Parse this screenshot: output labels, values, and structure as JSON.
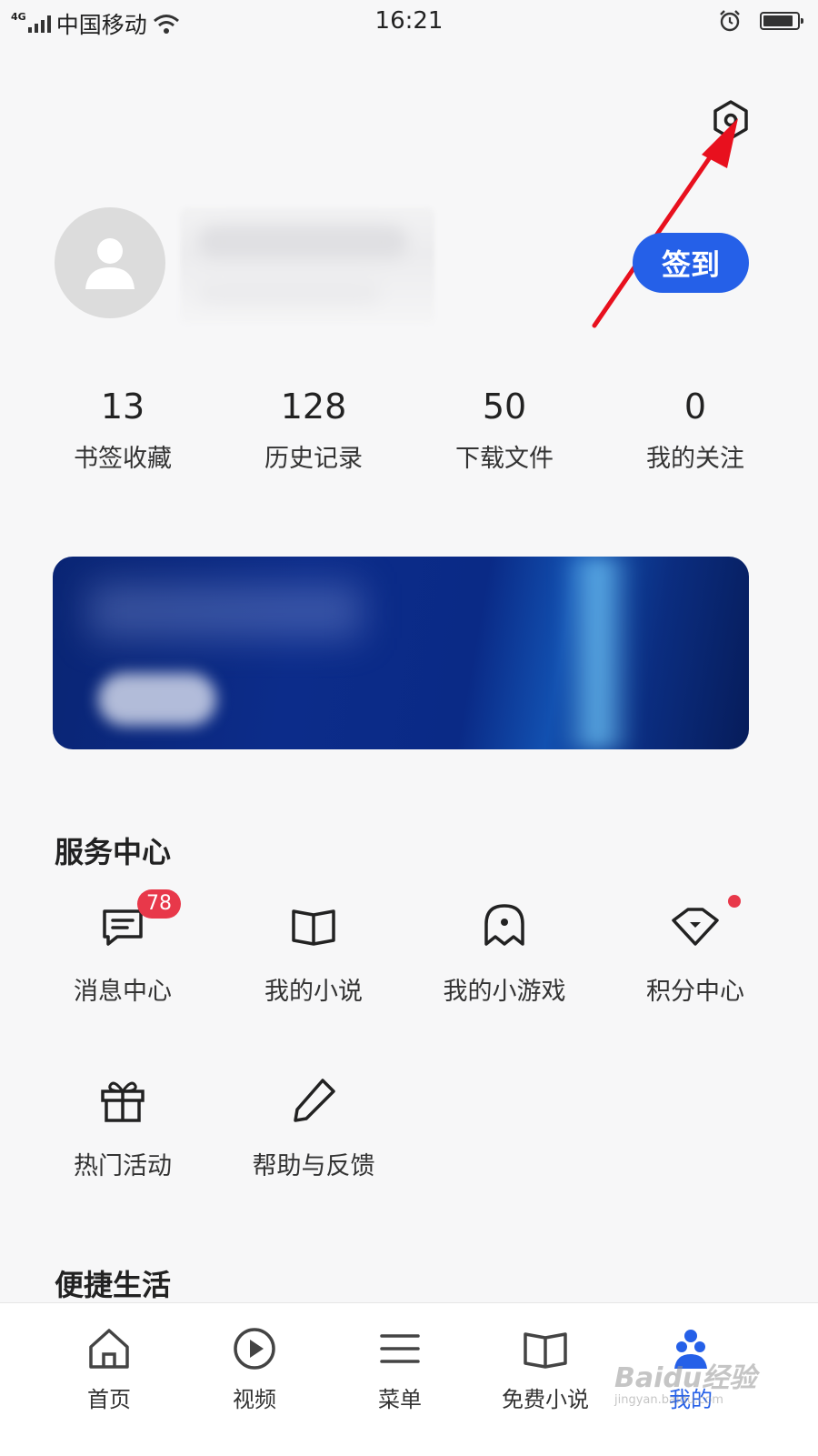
{
  "status_bar": {
    "network_type": "4G",
    "carrier": "中国移动",
    "time": "16:21",
    "battery_percent": 90
  },
  "profile": {
    "checkin_label": "签到"
  },
  "stats": [
    {
      "value": "13",
      "label": "书签收藏"
    },
    {
      "value": "128",
      "label": "历史记录"
    },
    {
      "value": "50",
      "label": "下载文件"
    },
    {
      "value": "0",
      "label": "我的关注"
    }
  ],
  "service_center": {
    "title": "服务中心",
    "items": [
      {
        "label": "消息中心",
        "icon": "message-icon",
        "badge": "78"
      },
      {
        "label": "我的小说",
        "icon": "book-icon"
      },
      {
        "label": "我的小游戏",
        "icon": "ghost-icon"
      },
      {
        "label": "积分中心",
        "icon": "diamond-icon",
        "dot": true
      },
      {
        "label": "热门活动",
        "icon": "gift-icon"
      },
      {
        "label": "帮助与反馈",
        "icon": "pencil-icon"
      }
    ]
  },
  "convenient_life": {
    "title": "便捷生活"
  },
  "bottom_nav": [
    {
      "label": "首页",
      "icon": "home-icon"
    },
    {
      "label": "视频",
      "icon": "play-icon"
    },
    {
      "label": "菜单",
      "icon": "menu-icon"
    },
    {
      "label": "免费小说",
      "icon": "book-icon"
    },
    {
      "label": "我的",
      "icon": "profile-icon",
      "active": true
    }
  ],
  "watermark": {
    "brand": "Baidu经验",
    "url": "jingyan.baidu.com"
  },
  "colors": {
    "accent": "#2560e8",
    "badge": "#e8384a",
    "annotation_arrow": "#e8101e"
  }
}
